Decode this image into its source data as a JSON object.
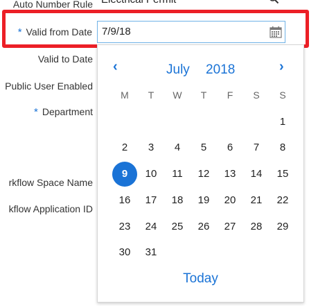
{
  "form": {
    "auto_number_rule_label": "Auto Number Rule",
    "auto_number_rule_value": "Electrical Permit",
    "valid_from_required": "*",
    "valid_from_label": "Valid from Date",
    "valid_from_value": "7/9/18",
    "valid_to_label": "Valid to Date",
    "public_user_label": "Public User Enabled",
    "department_required": "*",
    "department_label": "Department",
    "workflow_space_label": "rkflow Space Name",
    "workflow_app_label": "kflow Application ID"
  },
  "calendar": {
    "prev_icon": "‹",
    "next_icon": "›",
    "month": "July",
    "year": "2018",
    "weekdays": [
      "M",
      "T",
      "W",
      "T",
      "F",
      "S",
      "S"
    ],
    "weeks": [
      [
        "",
        "",
        "",
        "",
        "",
        "",
        "1"
      ],
      [
        "2",
        "3",
        "4",
        "5",
        "6",
        "7",
        "8"
      ],
      [
        "9",
        "10",
        "11",
        "12",
        "13",
        "14",
        "15"
      ],
      [
        "16",
        "17",
        "18",
        "19",
        "20",
        "21",
        "22"
      ],
      [
        "23",
        "24",
        "25",
        "26",
        "27",
        "28",
        "29"
      ],
      [
        "30",
        "31",
        "",
        "",
        "",
        "",
        ""
      ]
    ],
    "selected_day": "9",
    "today_label": "Today"
  },
  "colors": {
    "accent": "#1a73d6",
    "highlight_border": "#ec1f26"
  }
}
